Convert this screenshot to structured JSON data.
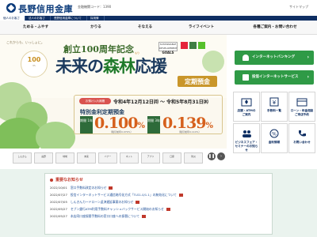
{
  "header": {
    "brand": "長野信用金庫",
    "institution_code": "金融機関コード：1390",
    "sitemap": "サイトマップ"
  },
  "subnav": {
    "tabs": [
      {
        "label": "個人のお客さま"
      },
      {
        "label": "法人のお客さま"
      },
      {
        "label": "長野信用金庫について"
      },
      {
        "label": "採用情報"
      }
    ]
  },
  "mainnav": {
    "items": [
      {
        "label": "ためる・ふやす"
      },
      {
        "label": "かりる"
      },
      {
        "label": "そなえる"
      },
      {
        "label": "ライフイベント"
      },
      {
        "label": "各種ご案内・お問い合わせ"
      }
    ]
  },
  "hero": {
    "tagline": "これからも、いっしょに。",
    "badge_number": "100",
    "badge_text": "th",
    "anniversary": "創立100周年記念",
    "sdgs_title": "GOALS",
    "sdgs_sub": "SUSTAINABLE DEVELOPMENT",
    "headline_pre": "未来の",
    "headline_forest": "森林",
    "headline_post": "応援",
    "ruby": "もり",
    "teiki": "定期預金",
    "period_label": "お預け入れ期間",
    "period": "令和4年12月12日㈪ ～ 令和5年8月31日㈭",
    "special": "特別金利定期預金",
    "term1": "期間 1年",
    "rate1": "0.100",
    "note1": "（税引前年0.079%）",
    "term2": "期間 3年",
    "rate2": "0.139",
    "note2": "（税引前年0.110%）",
    "percent": "%"
  },
  "slider": {
    "thumbs": [
      "しんきん",
      "長野",
      "地域",
      "未来",
      "バナー",
      "ネット",
      "アプリ",
      "口座",
      "防災"
    ]
  },
  "sidebar": {
    "banking": "インターネットバンキング",
    "investment": "投信インターネットサービス",
    "tiles": [
      {
        "label": "店舗・ATMの\nご案内"
      },
      {
        "label": "手数料一覧"
      },
      {
        "label": "ローン・年金相談\nご来店予約"
      },
      {
        "label": "ビジネスフェア・\nセミナーのお知らせ"
      },
      {
        "label": "金利情報"
      },
      {
        "label": "お問い合わせ"
      }
    ]
  },
  "notices": {
    "heading": "重要なお知らせ",
    "items": [
      {
        "date": "2022/10/01",
        "text": "窓口手数料改定のお知らせ"
      },
      {
        "date": "2022/07/27",
        "text": "投信インターネットサービス通信暗号化方式「TLS1.0/1.1」の無効化について"
      },
      {
        "date": "2022/07/05",
        "text": "しんきんカードローン返済遅延事案のお知らせ"
      },
      {
        "date": "2022/05/27",
        "text": "セブン銀行ATM利用手数料キャッシュバックサービス開始のお知らせ"
      },
      {
        "date": "2022/05/27",
        "text": "本店同口座振替手数料の窓口口座への振替について"
      }
    ]
  },
  "colors": {
    "navy": "#0f2f63",
    "green": "#2f9a46",
    "orange": "#d6601c"
  }
}
